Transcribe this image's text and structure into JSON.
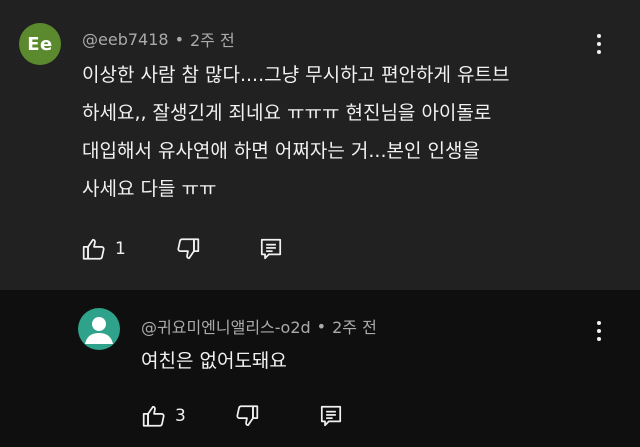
{
  "comments": [
    {
      "avatar": {
        "initials": "Ee",
        "color": "#5b8a2e"
      },
      "author": "@eeb7418",
      "separator": "•",
      "time": "2주 전",
      "lines": [
        "이상한 사람 참 많다....그냥 무시하고 편안하게 유트브",
        "하세요,, 잘생긴게 죄네요 ㅠㅠㅠ 현진님을 아이돌로",
        "대입해서 유사연애 하면 어쩌자는 거...본인 인생을",
        "사세요 다들 ㅠㅠ"
      ],
      "likes": "1",
      "icons": {
        "like": "thumbs-up-icon",
        "dislike": "thumbs-down-icon",
        "reply": "reply-icon",
        "more": "more-vert-icon"
      }
    },
    {
      "avatar": {
        "initials": "",
        "color": "#2ea28a"
      },
      "author": "@귀요미엔니앨리스-o2d",
      "separator": "•",
      "time": "2주 전",
      "lines": [
        "여친은 없어도돼요"
      ],
      "likes": "3",
      "icons": {
        "like": "thumbs-up-icon",
        "dislike": "thumbs-down-icon",
        "reply": "reply-icon",
        "more": "more-vert-icon"
      }
    }
  ]
}
